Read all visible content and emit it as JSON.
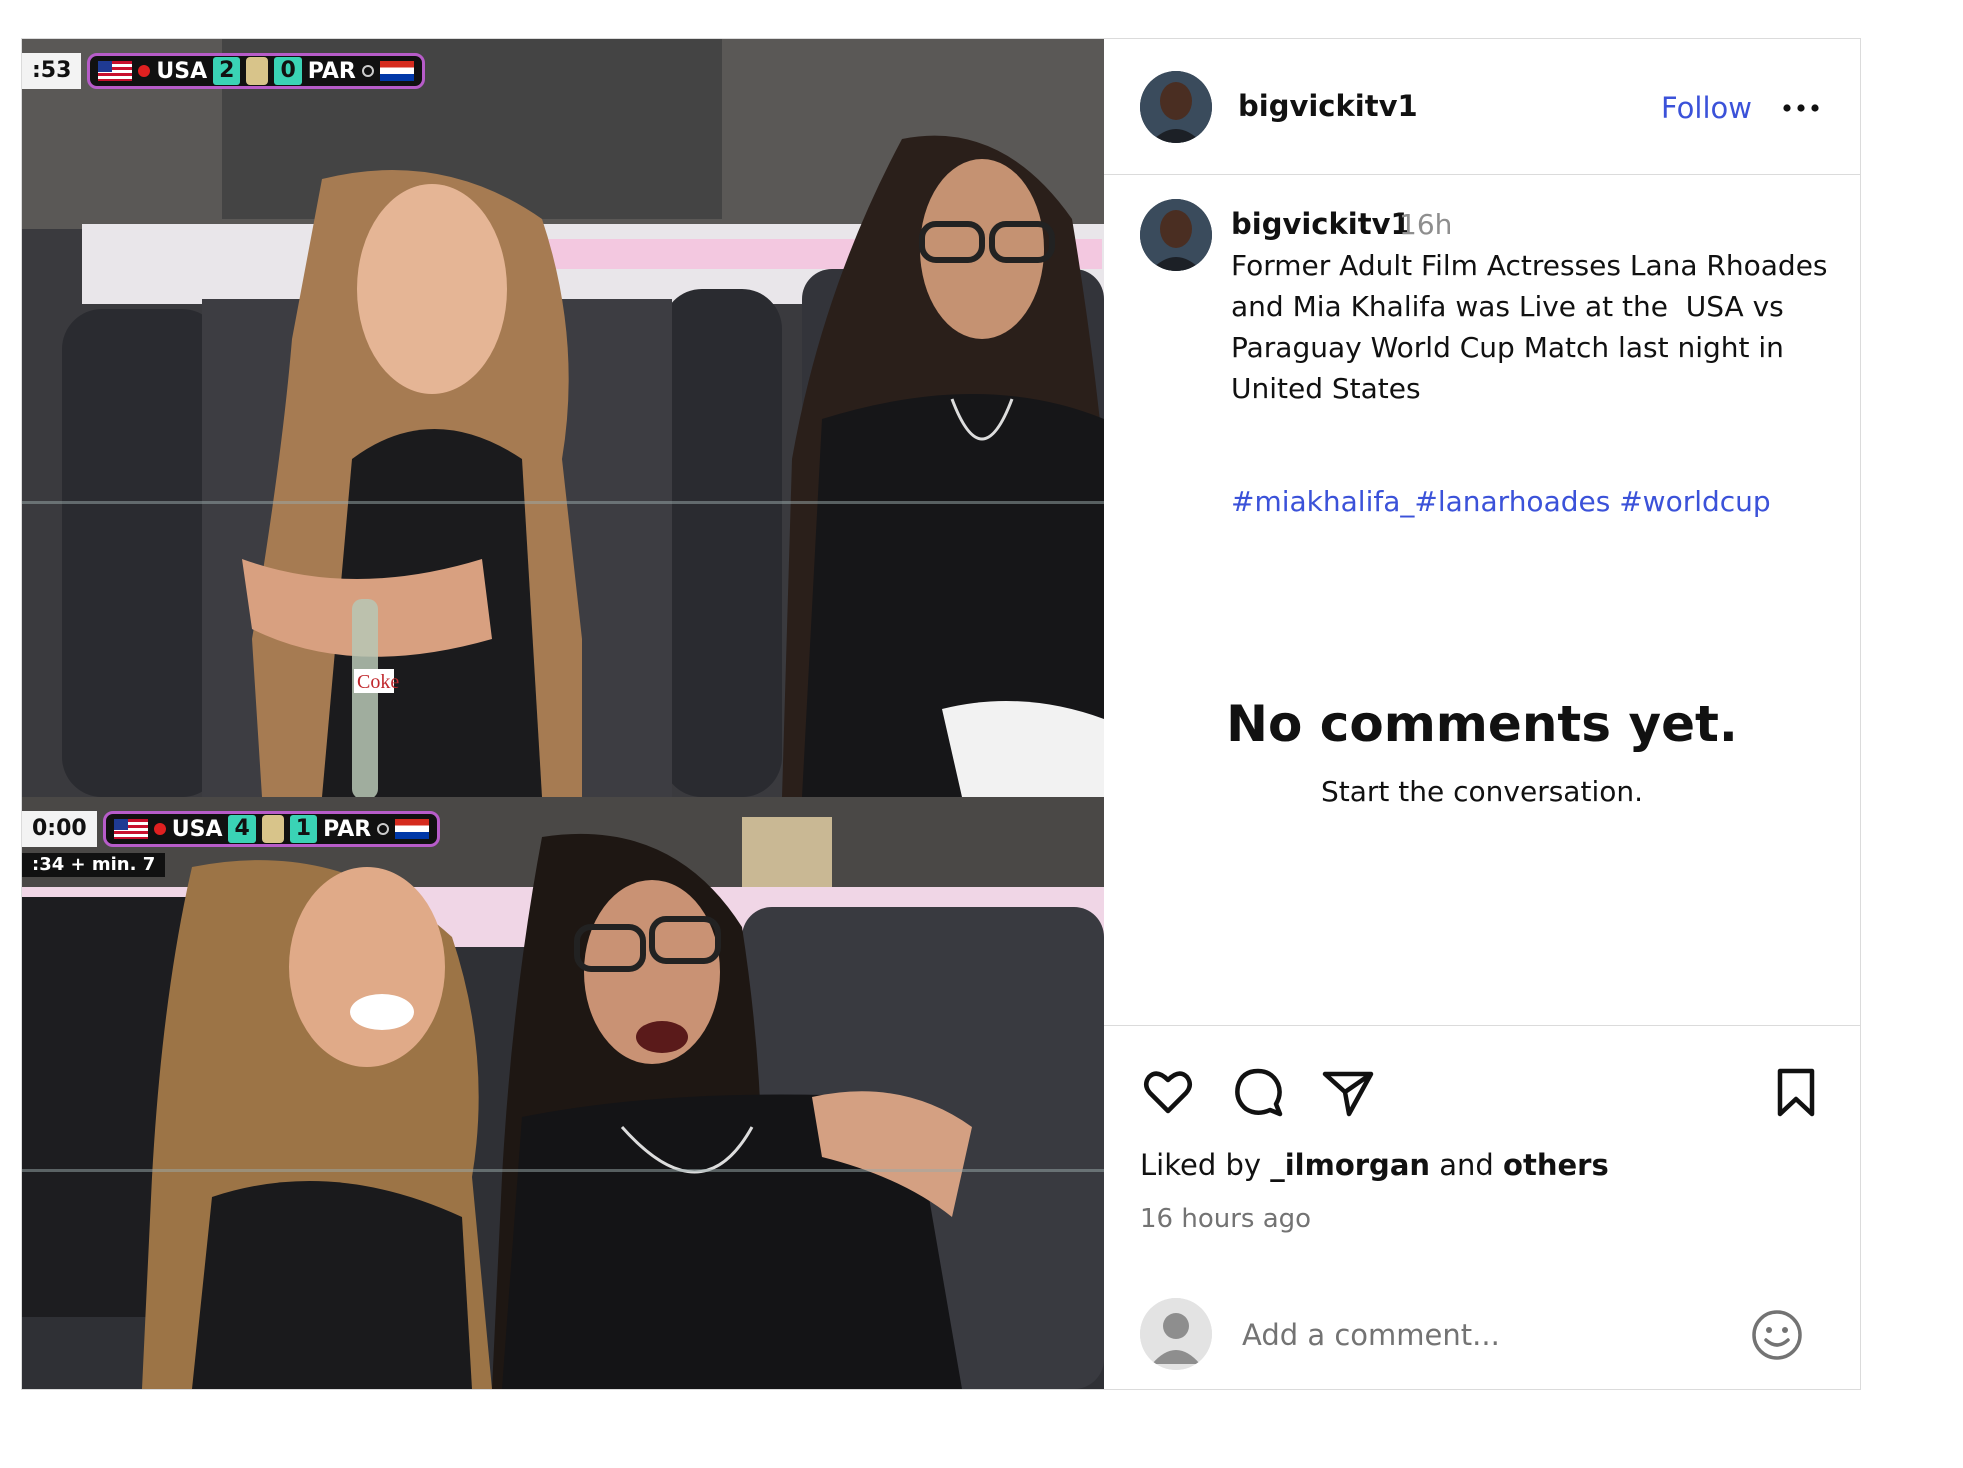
{
  "post": {
    "author": "bigvickitv1",
    "follow_label": "Follow",
    "more_icon": "more-horizontal-icon",
    "caption": {
      "username": "bigvickitv1",
      "time": "16h",
      "text": "Former Adult Film Actresses Lana Rhoades and Mia Khalifa was Live at the  USA vs Paraguay World Cup Match last night in United States",
      "hashtags": "#miakhalifa_#lanarhoades #worldcup"
    },
    "empty_comments": {
      "title": "No comments yet.",
      "subtitle": "Start the conversation."
    },
    "liked_by": {
      "prefix": "Liked by ",
      "user": "_ilmorgan",
      "middle": " and ",
      "others": "others"
    },
    "timestamp": "16 hours ago",
    "comment_box": {
      "placeholder": "Add a comment..."
    },
    "icons": [
      "heart-icon",
      "comment-icon",
      "share-icon",
      "bookmark-icon",
      "emoji-icon"
    ]
  },
  "media": {
    "scorebug_top": {
      "clock": ":53",
      "home": "USA",
      "home_score": "2",
      "away": "PAR",
      "away_score": "0"
    },
    "scorebug_bottom": {
      "clock": "0:00",
      "home": "USA",
      "home_score": "4",
      "away": "PAR",
      "away_score": "1",
      "subclock": ":34 + min. 7"
    },
    "bottle_label": "Coke"
  }
}
